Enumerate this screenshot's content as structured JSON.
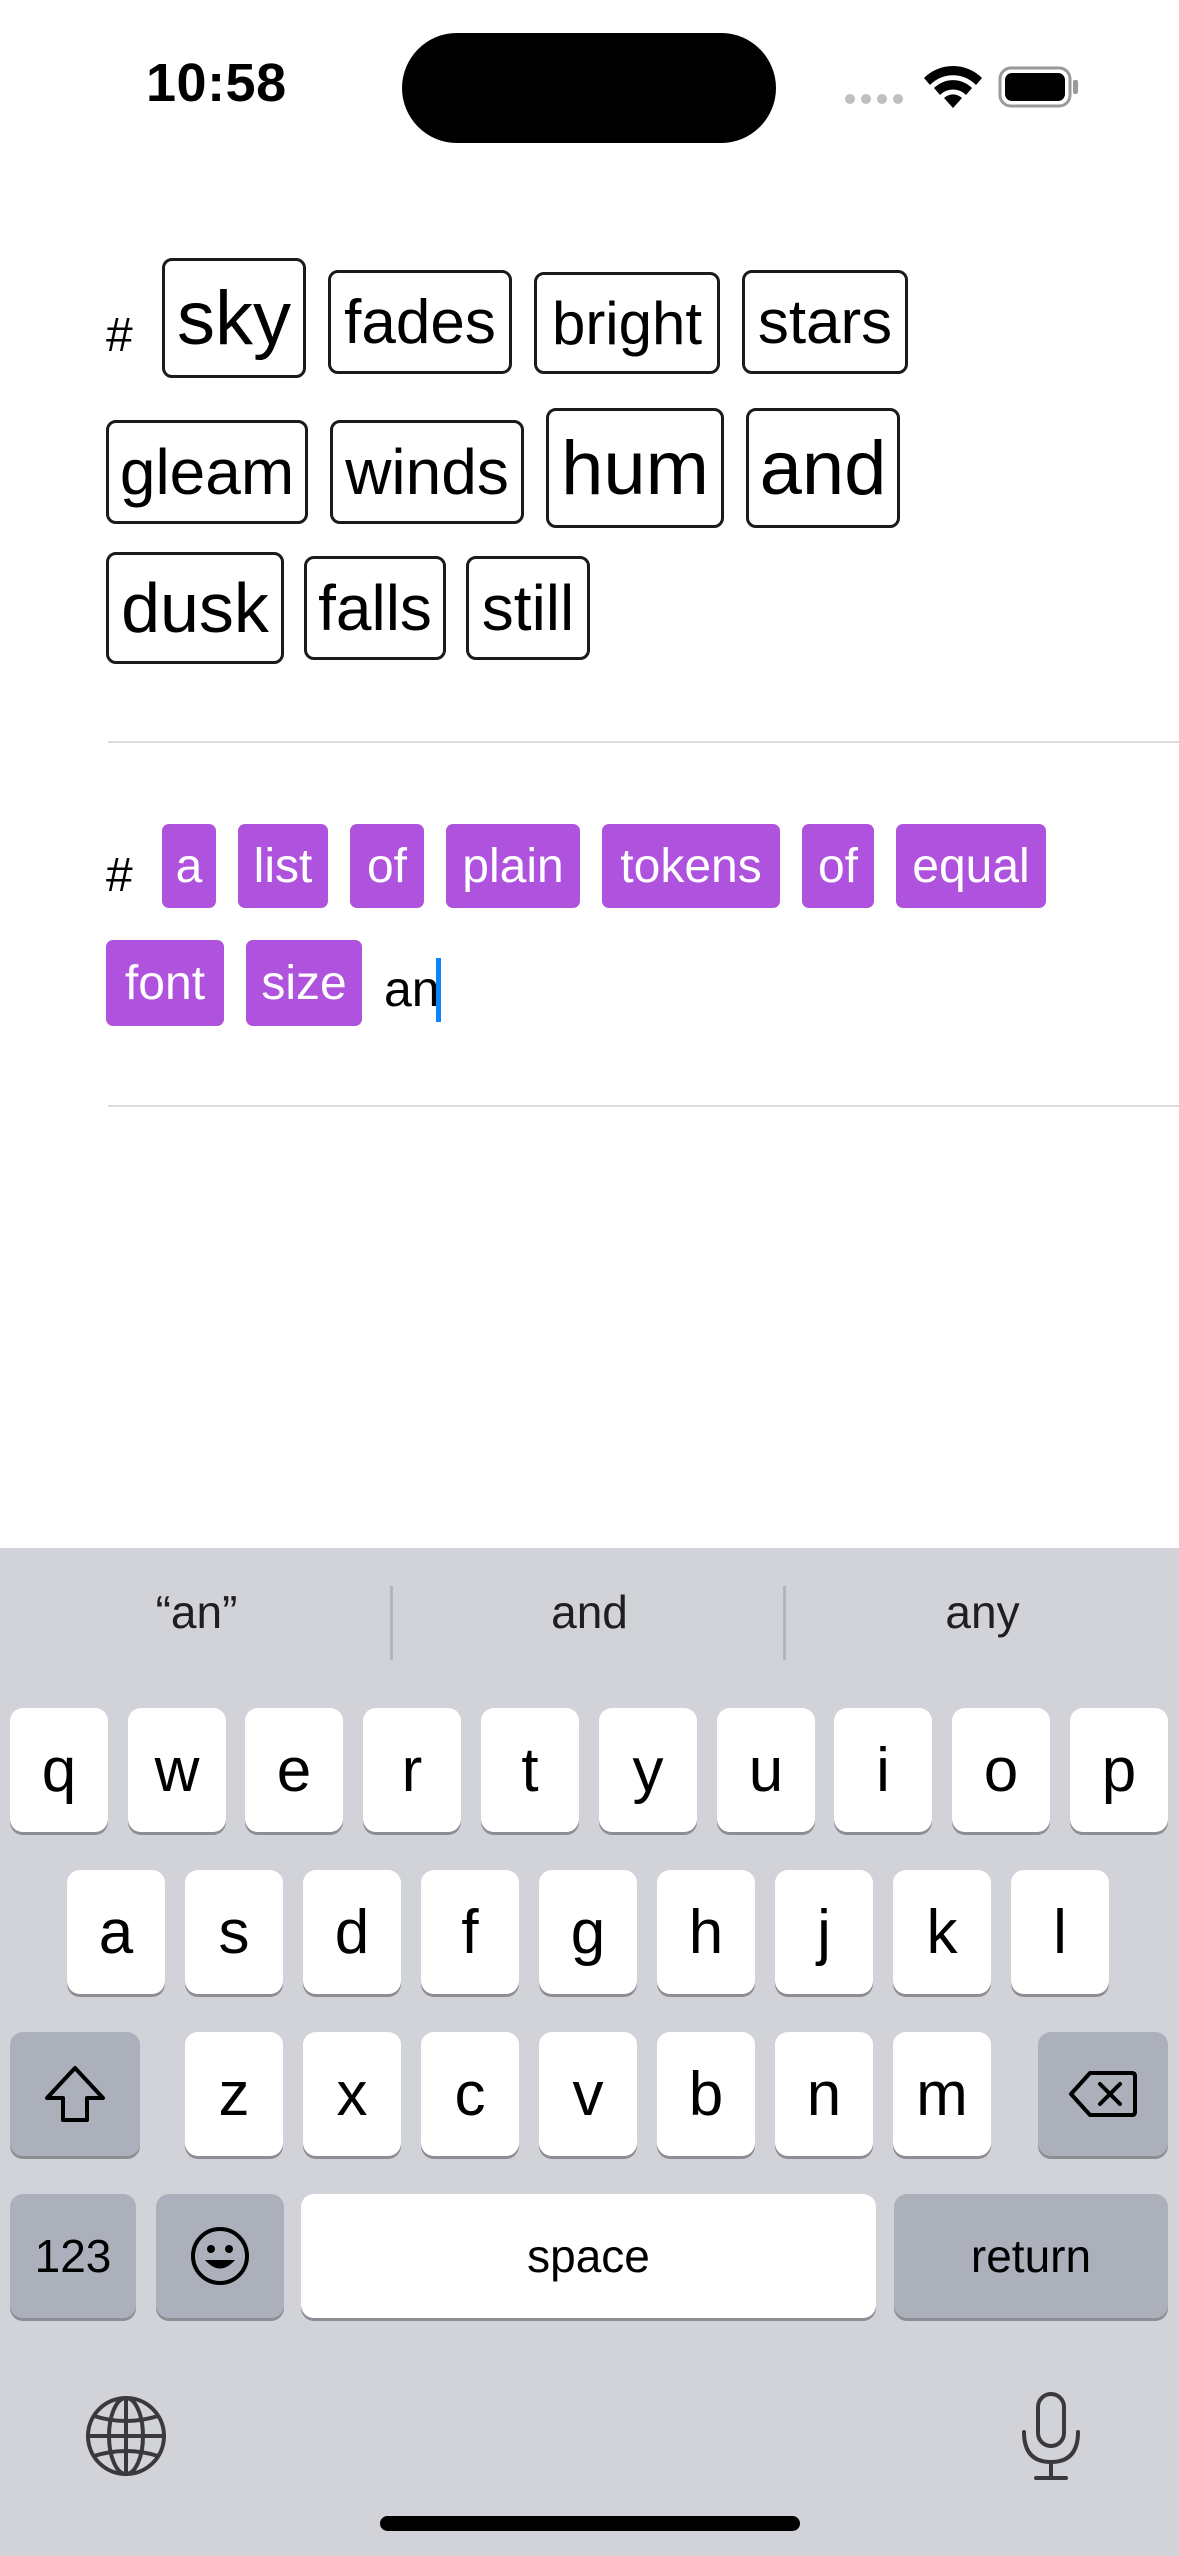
{
  "status_bar": {
    "time": "10:58"
  },
  "field1": {
    "hash": "#",
    "tokens": [
      "sky",
      "fades",
      "bright",
      "stars",
      "gleam",
      "winds",
      "hum",
      "and",
      "dusk",
      "falls",
      "still"
    ]
  },
  "field2": {
    "hash": "#",
    "tokens": [
      "a",
      "list",
      "of",
      "plain",
      "tokens",
      "of",
      "equal",
      "font",
      "size"
    ],
    "typed_text": "an",
    "token_color": "#af52de"
  },
  "keyboard": {
    "suggestions": [
      "“an”",
      "and",
      "any"
    ],
    "row1": [
      "q",
      "w",
      "e",
      "r",
      "t",
      "y",
      "u",
      "i",
      "o",
      "p"
    ],
    "row2": [
      "a",
      "s",
      "d",
      "f",
      "g",
      "h",
      "j",
      "k",
      "l"
    ],
    "row3": [
      "z",
      "x",
      "c",
      "v",
      "b",
      "n",
      "m"
    ],
    "numbers_label": "123",
    "space_label": "space",
    "return_label": "return",
    "icons": [
      "shift-icon",
      "delete-icon",
      "emoji-icon",
      "globe-icon",
      "microphone-icon"
    ]
  }
}
